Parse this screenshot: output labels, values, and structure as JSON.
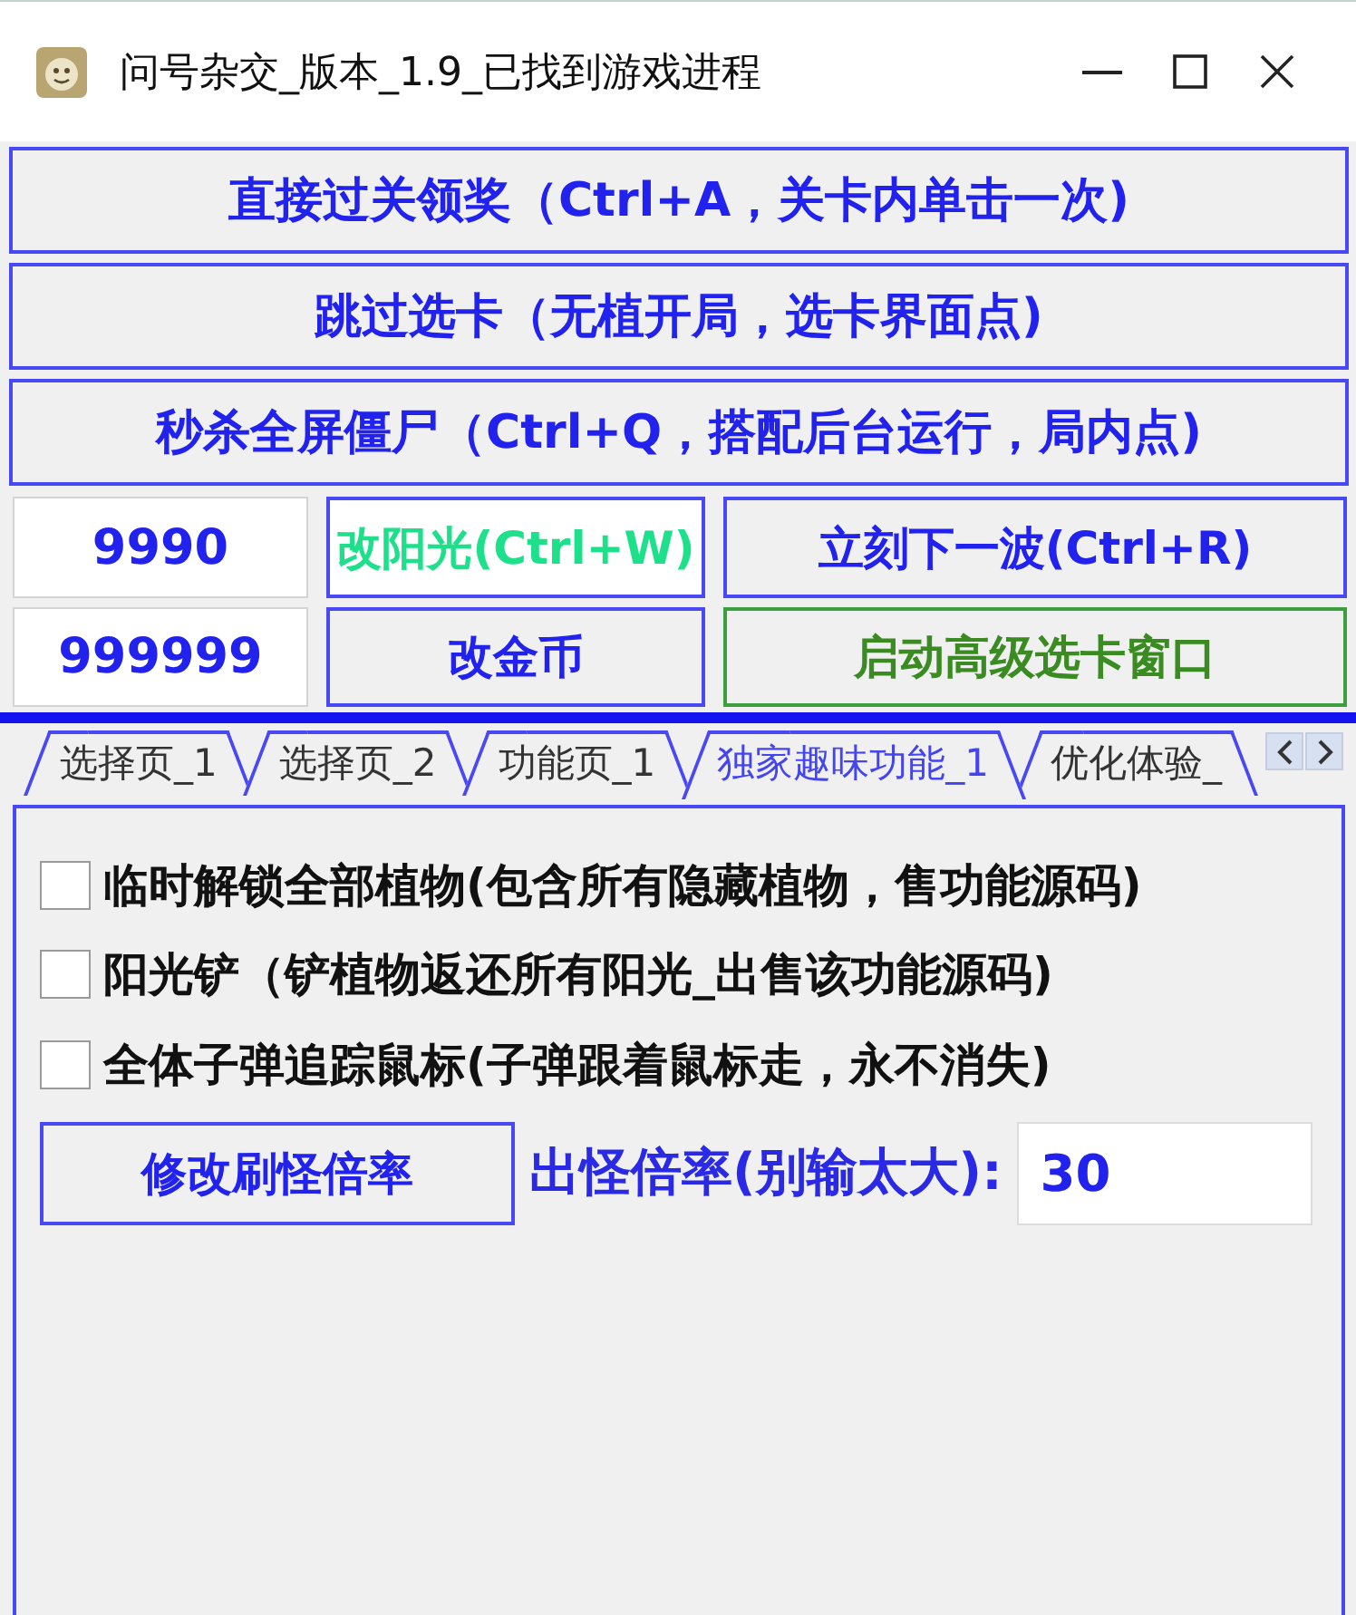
{
  "window": {
    "title": "问号杂交_版本_1.9_已找到游戏进程"
  },
  "action_buttons": [
    {
      "label": "直接过关领奖（Ctrl+A，关卡内单击一次)"
    },
    {
      "label": "跳过选卡（无植开局，选卡界面点)"
    },
    {
      "label": "秒杀全屏僵尸（Ctrl+Q，搭配后台运行，局内点)"
    }
  ],
  "value_rows": [
    {
      "field": {
        "value": "9990"
      },
      "buttons": [
        {
          "label": "改阳光(Ctrl+W)",
          "kind": "accent"
        },
        {
          "label": "立刻下一波(Ctrl+R)",
          "kind": "default"
        }
      ]
    },
    {
      "field": {
        "value": "999999"
      },
      "buttons": [
        {
          "label": "改金币",
          "kind": "default"
        },
        {
          "label": "启动高级选卡窗口",
          "kind": "go"
        }
      ]
    }
  ],
  "tabs": [
    {
      "label": "选择页_1",
      "selected": false
    },
    {
      "label": "选择页_2",
      "selected": false
    },
    {
      "label": "功能页_1",
      "selected": false
    },
    {
      "label": "独家趣味功能_1",
      "selected": true
    },
    {
      "label": "优化体验_",
      "selected": false
    }
  ],
  "panel": {
    "options": [
      {
        "label": "临时解锁全部植物(包含所有隐藏植物，售功能源码)",
        "checked": false
      },
      {
        "label": "阳光铲（铲植物返还所有阳光_出售该功能源码)",
        "checked": false
      },
      {
        "label": "全体子弹追踪鼠标(子弹跟着鼠标走，永不消失)",
        "checked": false
      }
    ],
    "rate_button": {
      "label": "修改刷怪倍率"
    },
    "rate_field": {
      "label": "出怪倍率(别输太大):",
      "value": "30"
    }
  }
}
